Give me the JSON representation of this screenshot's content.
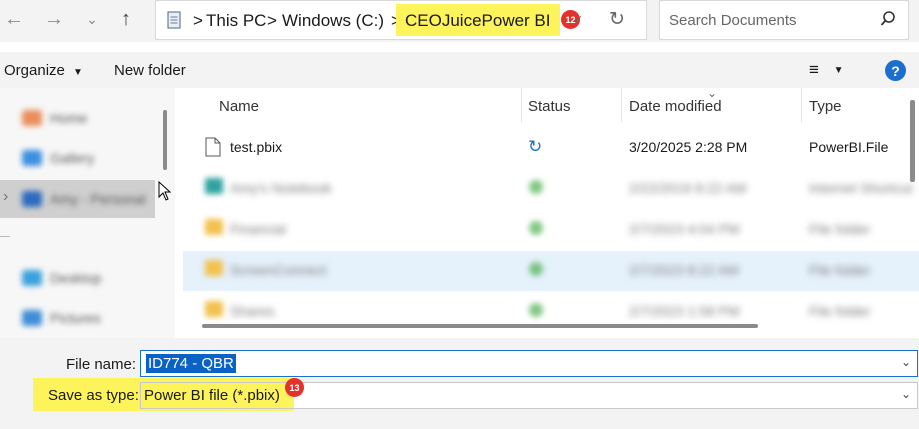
{
  "address_bar": {
    "breadcrumbs": [
      "This PC",
      "Windows (C:)",
      "CEOJuicePower BI"
    ],
    "separator": ">",
    "badge": "12",
    "highlight_color": "#fdf35a",
    "badge_color": "#e5312b"
  },
  "search": {
    "placeholder": "Search Documents",
    "icon": "search-icon"
  },
  "toolbar": {
    "organize_label": "Organize",
    "new_folder_label": "New folder",
    "help_label": "?"
  },
  "nav": {
    "items": [
      "Home",
      "Gallery",
      "Amy - Personal",
      "Desktop",
      "Pictures"
    ]
  },
  "columns": {
    "name": "Name",
    "status": "Status",
    "date": "Date modified",
    "type": "Type"
  },
  "files": [
    {
      "name": "test.pbix",
      "date": "3/20/2025 2:28 PM",
      "type": "PowerBI.File",
      "status_icon": "sync-icon",
      "blurred": false
    },
    {
      "name": "Amy's Notebook",
      "date": "2/22/2019 8:22 AM",
      "type": "Internet Shortcut",
      "blurred": true
    },
    {
      "name": "Financial",
      "date": "2/7/2023 4:04 PM",
      "type": "File folder",
      "blurred": true
    },
    {
      "name": "ScreenConnect",
      "date": "2/7/2023 8:22 AM",
      "type": "File folder",
      "blurred": true,
      "selected": true
    },
    {
      "name": "Shares",
      "date": "2/7/2023 1:58 PM",
      "type": "File folder",
      "blurred": true
    }
  ],
  "form": {
    "file_name_label": "File name:",
    "file_name_value": "ID774 - QBR",
    "save_type_label": "Save as type:",
    "save_type_value": "Power BI file (*.pbix)",
    "badge": "13"
  }
}
